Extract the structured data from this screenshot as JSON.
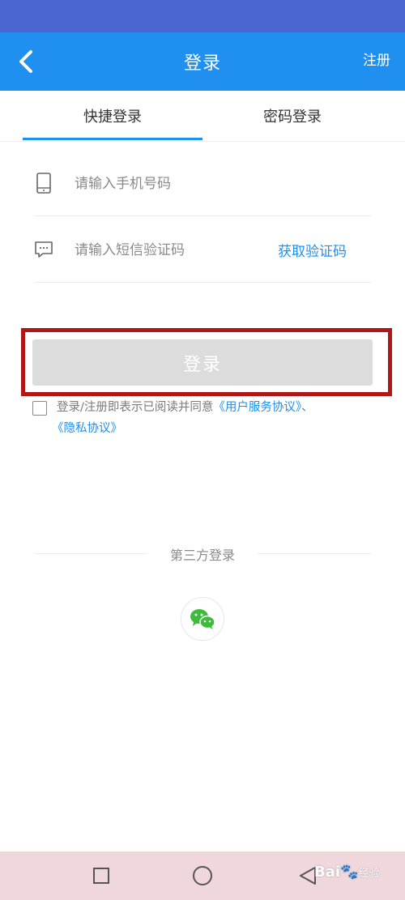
{
  "header": {
    "title": "登录",
    "register_label": "注册"
  },
  "tabs": [
    {
      "label": "快捷登录",
      "active": true
    },
    {
      "label": "密码登录",
      "active": false
    }
  ],
  "form": {
    "phone_placeholder": "请输入手机号码",
    "code_placeholder": "请输入短信验证码",
    "get_code_label": "获取验证码",
    "submit_label": "登录"
  },
  "agreement": {
    "checked": false,
    "text": "登录/注册即表示已阅读并同意",
    "service_link": "《用户服务协议》",
    "separator": "、",
    "privacy_link": "《隐私协议》"
  },
  "third_party": {
    "title": "第三方登录",
    "providers": [
      {
        "icon": "wechat-icon"
      }
    ]
  },
  "colors": {
    "status_bar": "#4a64d0",
    "primary": "#1f8ff0",
    "button_disabled": "#dcdcdc",
    "highlight_border": "#b01818",
    "system_nav": "#f0d7dc"
  },
  "watermark": {
    "brand": "Bai",
    "suffix": "经验"
  }
}
